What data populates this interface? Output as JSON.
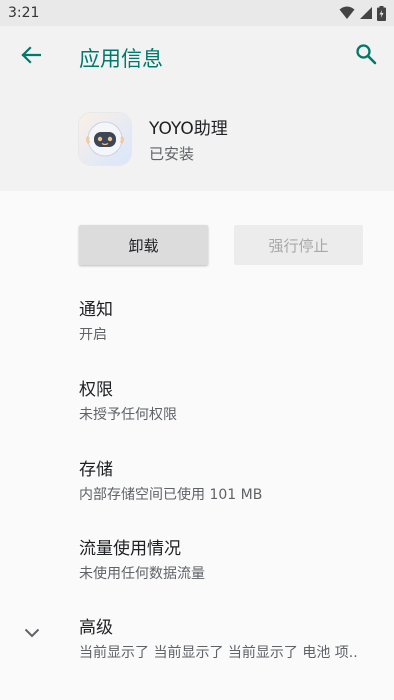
{
  "status_bar": {
    "time": "3:21",
    "icons": [
      "wifi-icon",
      "cellular-signal-icon",
      "battery-icon"
    ]
  },
  "app_bar": {
    "title": "应用信息",
    "back_icon": "arrow-back-icon",
    "search_icon": "search-icon",
    "accent_color": "#00796b"
  },
  "app": {
    "name": "YOYO助理",
    "status": "已安装",
    "icon": "yoyo-robot-icon"
  },
  "buttons": {
    "uninstall": "卸载",
    "force_stop": "强行停止",
    "force_stop_enabled": false
  },
  "items": [
    {
      "title": "通知",
      "subtitle": "开启"
    },
    {
      "title": "权限",
      "subtitle": "未授予任何权限"
    },
    {
      "title": "存储",
      "subtitle": "内部存储空间已使用 101 MB"
    },
    {
      "title": "流量使用情况",
      "subtitle": "未使用任何数据流量"
    },
    {
      "title": "高级",
      "subtitle": "当前显示了 当前显示了 当前显示了 电池 项..",
      "icon": "chevron-down-icon"
    }
  ]
}
